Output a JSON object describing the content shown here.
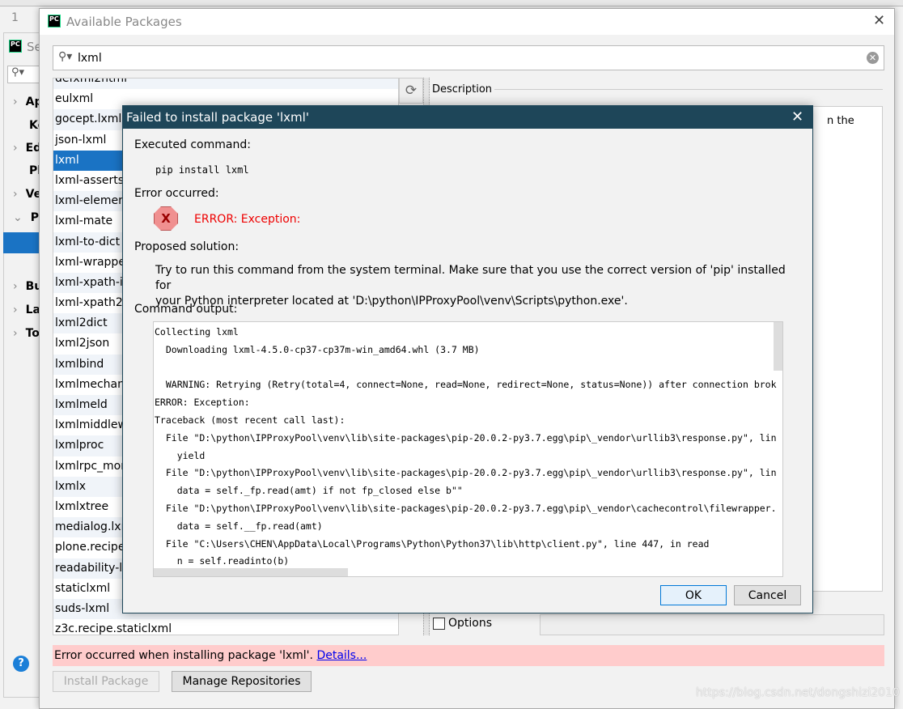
{
  "background": {
    "line_number": "1",
    "settings_title": "Se",
    "tree_items": [
      {
        "label": "Ap",
        "chevron": true
      },
      {
        "label": "Ke",
        "chevron": false
      },
      {
        "label": "Ed",
        "chevron": true
      },
      {
        "label": "Pl",
        "chevron": false
      },
      {
        "label": "Ve",
        "chevron": true
      },
      {
        "label": "Pr",
        "chevron": "expanded"
      },
      {
        "label": "Bu",
        "chevron": true
      },
      {
        "label": "La",
        "chevron": true
      },
      {
        "label": "To",
        "chevron": true
      }
    ],
    "help_icon": "?",
    "watermark": "https://blog.csdn.net/dongshizi2010"
  },
  "packages_dialog": {
    "title": "Available Packages",
    "app_icon": "PC",
    "search_value": "lxml",
    "packages": [
      "defxml2html",
      "eulxml",
      "gocept.lxml",
      "json-lxml",
      "lxml",
      "lxml-asserts",
      "lxml-element",
      "lxml-mate",
      "lxml-to-dict",
      "lxml-wrappe",
      "lxml-xpath-ip",
      "lxml-xpath2-",
      "lxml2dict",
      "lxml2json",
      "lxmlbind",
      "lxmlmechani",
      "lxmlmeld",
      "lxmlmiddlew",
      "lxmlproc",
      "lxmlrpc_mon",
      "lxmlx",
      "lxmlxtree",
      "medialog.lxm",
      "plone.recipe.",
      "readability-lx",
      "staticlxml",
      "suds-lxml",
      "z3c.recipe.staticlxml"
    ],
    "selected_package": "lxml",
    "description_label": "Description",
    "description_fragment": "n the",
    "options_label": "Options",
    "error_message": "Error occurred when installing package 'lxml'.",
    "details_link": "Details...",
    "install_button": "Install Package",
    "manage_button": "Manage Repositories"
  },
  "error_modal": {
    "title": "Failed to install package 'lxml'",
    "executed_label": "Executed command:",
    "command": "pip install lxml",
    "error_label": "Error occurred:",
    "error_text": "ERROR: Exception:",
    "solution_label": "Proposed solution:",
    "solution_line1": "Try to run this command from the system terminal. Make sure that you use the correct version of 'pip' installed for",
    "solution_line2": "your Python interpreter located at 'D:\\python\\IPProxyPool\\venv\\Scripts\\python.exe'.",
    "output_label": "Command output:",
    "output": "Collecting lxml\n  Downloading lxml-4.5.0-cp37-cp37m-win_amd64.whl (3.7 MB)\n\n  WARNING: Retrying (Retry(total=4, connect=None, read=None, redirect=None, status=None)) after connection brok\nERROR: Exception:\nTraceback (most recent call last):\n  File \"D:\\python\\IPProxyPool\\venv\\lib\\site-packages\\pip-20.0.2-py3.7.egg\\pip\\_vendor\\urllib3\\response.py\", lin\n    yield\n  File \"D:\\python\\IPProxyPool\\venv\\lib\\site-packages\\pip-20.0.2-py3.7.egg\\pip\\_vendor\\urllib3\\response.py\", lin\n    data = self._fp.read(amt) if not fp_closed else b\"\"\n  File \"D:\\python\\IPProxyPool\\venv\\lib\\site-packages\\pip-20.0.2-py3.7.egg\\pip\\_vendor\\cachecontrol\\filewrapper.\n    data = self.__fp.read(amt)\n  File \"C:\\Users\\CHEN\\AppData\\Local\\Programs\\Python\\Python37\\lib\\http\\client.py\", line 447, in read\n    n = self.readinto(b)",
    "ok_button": "OK",
    "cancel_button": "Cancel"
  },
  "colors": {
    "modal_title_bg": "#1e4659",
    "selection": "#1a73c4",
    "error_bar": "#ffcccc",
    "error_text": "#e00000"
  }
}
